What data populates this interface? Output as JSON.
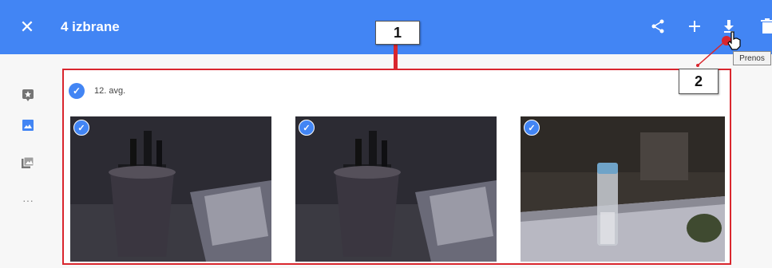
{
  "topbar": {
    "title": "4 izbrane",
    "close_icon": "close-icon",
    "share_icon": "share-icon",
    "add_icon": "plus-icon",
    "download_icon": "download-icon",
    "delete_icon": "trash-icon"
  },
  "tooltip": {
    "text": "Prenos"
  },
  "annotations": {
    "callout_1": "1",
    "callout_2": "2"
  },
  "sidebar": {
    "items": [
      {
        "icon": "assistant-icon"
      },
      {
        "icon": "photos-icon"
      },
      {
        "icon": "albums-icon"
      },
      {
        "icon": "more-icon",
        "label": "···"
      }
    ]
  },
  "content": {
    "date_label": "12. avg.",
    "photos": [
      {
        "name": "photo-1",
        "selected": true
      },
      {
        "name": "photo-2",
        "selected": true
      },
      {
        "name": "photo-3",
        "selected": true
      }
    ]
  },
  "colors": {
    "topbar": "#4285f4",
    "annotation_red": "#d9262e",
    "check_blue": "#4285f4"
  }
}
